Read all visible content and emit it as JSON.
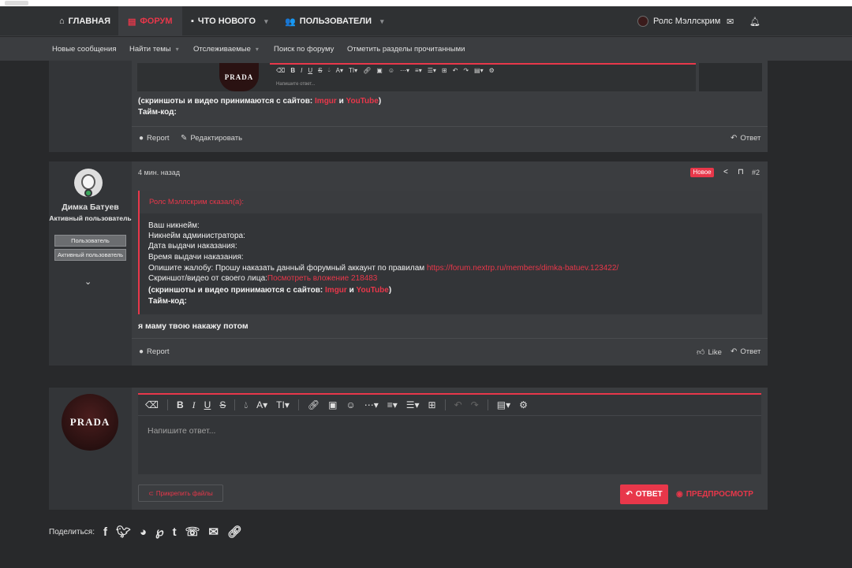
{
  "nav": {
    "home": "ГЛАВНАЯ",
    "forum": "ФОРУМ",
    "whats_new": "ЧТО НОВОГО",
    "members": "ПОЛЬЗОВАТЕЛИ",
    "user_name": "Ролс Мэллскрим"
  },
  "subnav": {
    "new_posts": "Новые сообщения",
    "find_threads": "Найти темы",
    "watched": "Отслеживаемые",
    "search_forums": "Поиск по форуму",
    "mark_read": "Отметить разделы прочитанными"
  },
  "post1": {
    "editor_placeholder": "Напишите ответ...",
    "avatar_text": "PRADA",
    "line_sources_prefix": "(скриншоты и видео принимаются с сайтов: ",
    "link_imgur": "Imgur",
    "and": " и ",
    "link_youtube": "YouTube",
    "line_sources_suffix": ")",
    "line_timecode": "Тайм-код:",
    "report": "Report",
    "edit": "Редактировать",
    "reply": "Ответ"
  },
  "post2": {
    "time": "4 мин. назад",
    "new_badge": "Новое",
    "number": "#2",
    "author": "Димка Батуев",
    "user_title": "Активный пользователь",
    "banner1": "Пользователь",
    "banner2": "Активный пользователь",
    "quote_author": "Ролс Мэллскрим сказал(а):",
    "quote_lines": {
      "l1": "Ваш никнейм:",
      "l2": "Никнейм администратора:",
      "l3": "Дата выдачи наказания:",
      "l4": "Время выдачи наказания:",
      "l5_prefix": "Опишите жалобу: Прошу наказать данный форумный аккаунт по правилам ",
      "l5_link": "https://forum.nextrp.ru/members/dimka-batuev.123422/",
      "l6_prefix": "Скриншот/видео от своего лица:",
      "l6_link": "Посмотреть вложение 218483",
      "l7_prefix": "(скриншоты и видео принимаются с сайтов: ",
      "l7_imgur": "Imgur",
      "l7_and": " и ",
      "l7_youtube": "YouTube",
      "l7_suffix": ")",
      "l8": "Тайм-код:"
    },
    "body": "я маму твою накажу потом",
    "report": "Report",
    "like": "Like",
    "reply": "Ответ"
  },
  "reply_box": {
    "avatar_text": "PRADA",
    "placeholder": "Напишите ответ...",
    "attach": "Прикрепить файлы",
    "send": "ОТВЕТ",
    "preview": "ПРЕДПРОСМОТР"
  },
  "share": {
    "label": "Поделиться:"
  },
  "colors": {
    "accent": "#e8374a",
    "background": "#28292b",
    "panel": "#3b3d40",
    "sidebar": "#333538",
    "online": "#3ba55c"
  }
}
